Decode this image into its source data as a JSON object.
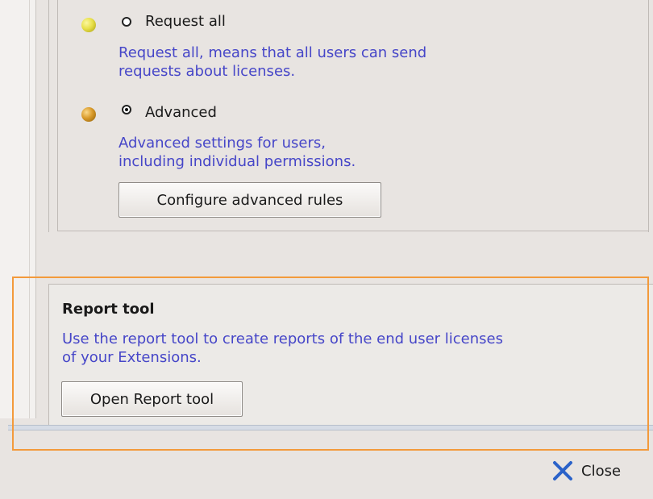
{
  "options": [
    {
      "label": "Request all",
      "description_line1": "Request all, means that all users can send",
      "description_line2": "requests about licenses.",
      "selected": false,
      "bullet_color": "#e8e04a"
    },
    {
      "label": "Advanced",
      "description_line1": "Advanced settings for users,",
      "description_line2": "including individual permissions.",
      "selected": true,
      "bullet_color": "#d99a2a"
    }
  ],
  "configure_button_label": "Configure advanced rules",
  "report": {
    "title": "Report tool",
    "description_line1": "Use the report tool to create reports of the end user licenses",
    "description_line2": "of your Extensions.",
    "button_label": "Open Report tool"
  },
  "footer": {
    "close_label": "Close",
    "close_icon": "x-icon"
  },
  "colors": {
    "link_text": "#4646c8",
    "highlight": "#f39a3b",
    "close_icon": "#2a62c9"
  }
}
